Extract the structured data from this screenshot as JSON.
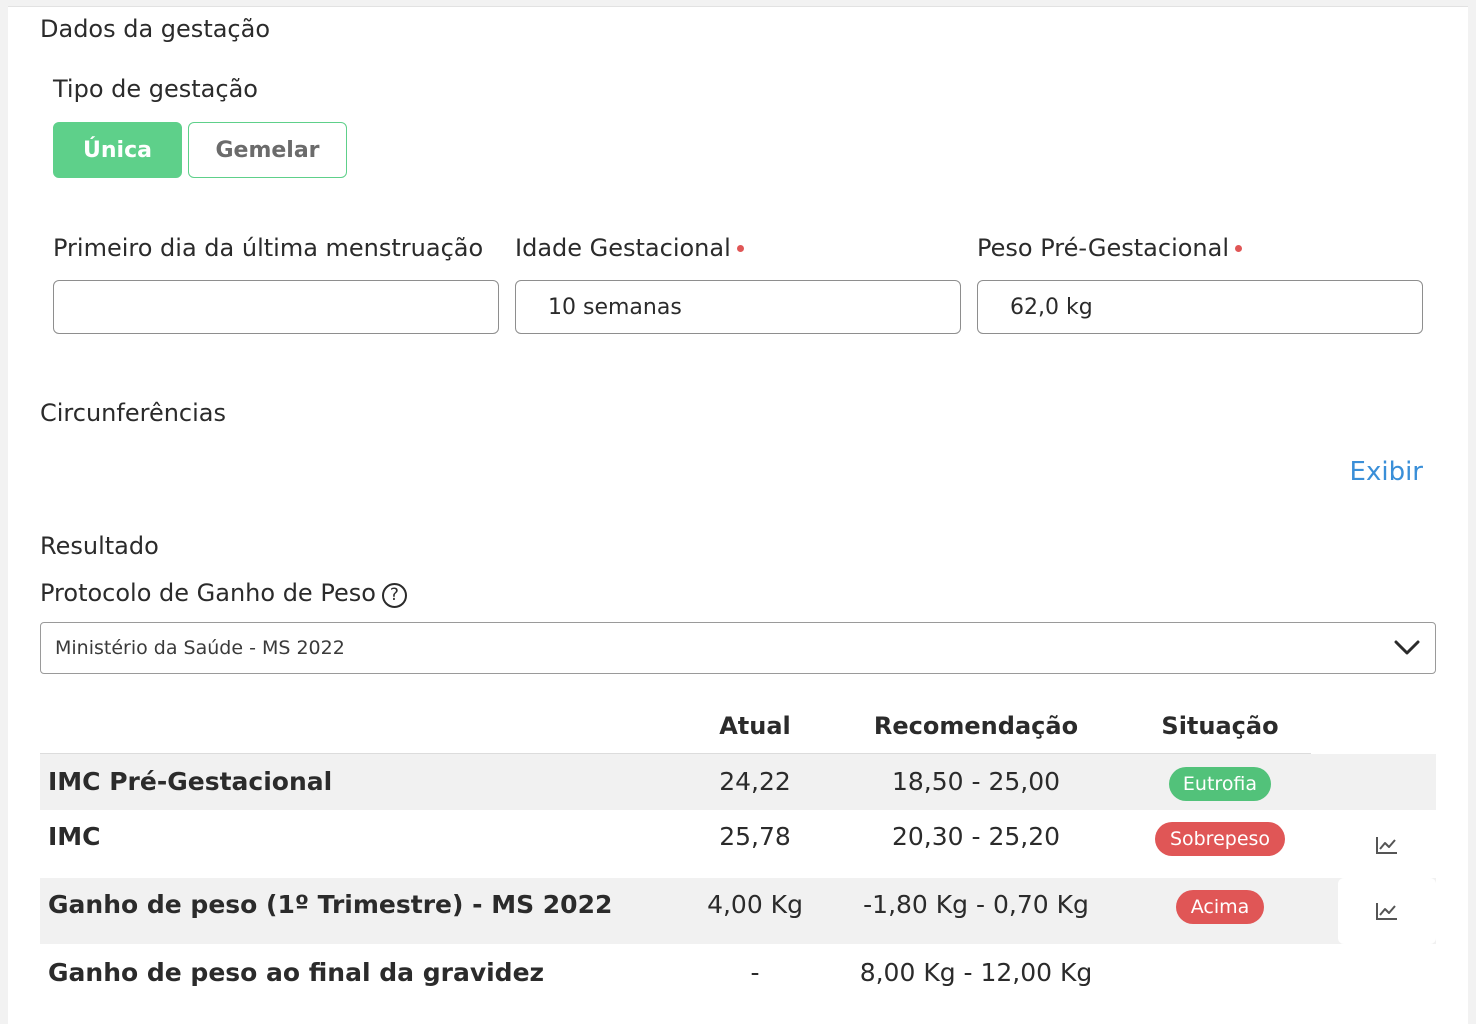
{
  "gestation": {
    "section_title": "Dados da gestação",
    "type_label": "Tipo de gestação",
    "type_options": [
      "Única",
      "Gemelar"
    ],
    "selected_type": "Única",
    "lmp_label": "Primeiro dia da última menstruação",
    "lmp_value": "",
    "ga_label": "Idade Gestacional",
    "ga_value": "10 semanas",
    "weight_label": "Peso Pré-Gestacional",
    "weight_value": "62,0 kg"
  },
  "circumferences": {
    "section_title": "Circunferências",
    "show_link": "Exibir"
  },
  "result": {
    "section_title": "Resultado",
    "protocol_label": "Protocolo de Ganho de Peso",
    "help_glyph": "?",
    "protocol_value": "Ministério da Saúde - MS 2022",
    "table": {
      "headers": [
        "Atual",
        "Recomendação",
        "Situação"
      ],
      "rows": [
        {
          "name": "IMC Pré-Gestacional",
          "current": "24,22",
          "recommendation": "18,50 - 25,00",
          "status": "Eutrofia",
          "status_color": "#52c27a"
        },
        {
          "name": "IMC",
          "current": "25,78",
          "recommendation": "20,30 - 25,20",
          "status": "Sobrepeso",
          "status_color": "#e05656"
        },
        {
          "name": "Ganho de peso (1º Trimestre) - MS 2022",
          "current": "4,00 Kg",
          "recommendation": "-1,80 Kg - 0,70 Kg",
          "status": "Acima",
          "status_color": "#e05656"
        },
        {
          "name": "Ganho de peso ao final da gravidez",
          "current": "-",
          "recommendation": "8,00 Kg - 12,00 Kg",
          "status": ""
        }
      ]
    }
  },
  "colors": {
    "accent_green": "#5ed08a",
    "link_blue": "#3a8fd8",
    "alert_red": "#e05656"
  },
  "icons": {
    "chart": "chart-trend-icon",
    "help": "help-circle-icon",
    "dropdown": "chevron-down-icon"
  }
}
